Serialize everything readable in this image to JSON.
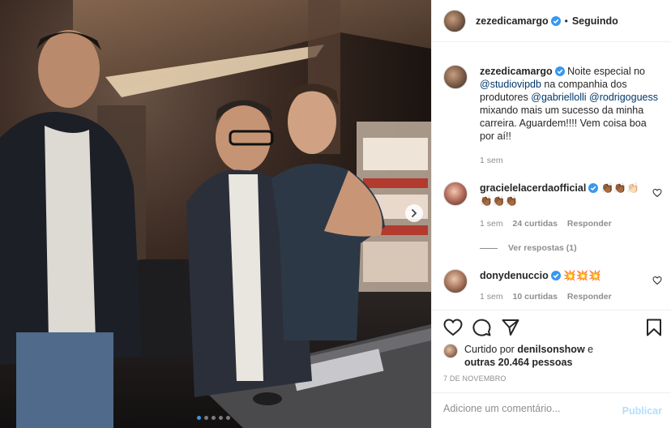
{
  "post": {
    "author": "zezedicamargo",
    "separator": "•",
    "follow_label": "Seguindo",
    "carousel_count": 5,
    "carousel_active": 0
  },
  "caption": {
    "author": "zezedicamargo",
    "text_1": "Noite especial no",
    "mention_1": "@studiovipdb",
    "text_2": "na companhia dos produtores",
    "mention_2": "@gabriellolli",
    "mention_3": "@rodrigoguess",
    "text_3": "mixando mais um sucesso da minha carreira. Aguardem!!!! Vem coisa boa por aí!!",
    "time": "1 sem"
  },
  "comments": [
    {
      "author": "gracielelacerdaofficial",
      "text": "👏🏾👏🏾👏🏻👏🏾👏🏾👏🏾",
      "time": "1 sem",
      "likes": "24 curtidas",
      "reply_label": "Responder",
      "view_replies": "Ver respostas (1)"
    },
    {
      "author": "donydenuccio",
      "text": "💥💥💥",
      "time": "1 sem",
      "likes": "10 curtidas",
      "reply_label": "Responder"
    }
  ],
  "likes_line": {
    "prefix": "Curtido por",
    "user": "denilsonshow",
    "conj": "e",
    "others": "outras 20.464 pessoas"
  },
  "date": "7 DE NOVEMBRO",
  "comment_box": {
    "placeholder": "Adicione um comentário...",
    "publish_label": "Publicar"
  },
  "colors": {
    "verified": "#3897f0",
    "link": "#00376b",
    "muted": "#8e8e8e",
    "publish_disabled": "#b2dffc"
  },
  "icons": [
    "heart-icon",
    "comment-icon",
    "share-icon",
    "bookmark-icon",
    "verified-icon",
    "next-arrow-icon"
  ]
}
